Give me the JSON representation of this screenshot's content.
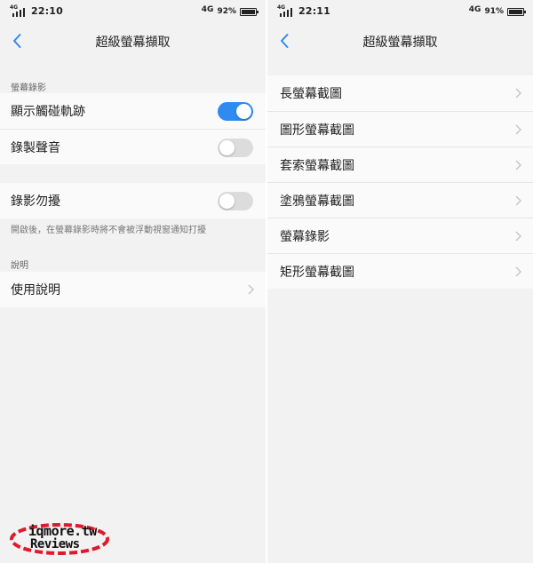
{
  "colors": {
    "accent": "#2f8bf0",
    "background": "#f2f2f2",
    "row_bg": "#fafafa",
    "watermark_ring": "#e0192b"
  },
  "left": {
    "status": {
      "network_tag": "4G",
      "time": "22:10",
      "network": "4G",
      "battery": "92%",
      "battery_level": 0.92
    },
    "title": "超級螢幕擷取",
    "section1_label": "螢幕錄影",
    "row_show_touch": {
      "label": "顯示觸碰軌跡",
      "toggle": "on"
    },
    "row_record_sound": {
      "label": "錄製聲音",
      "toggle": "off"
    },
    "row_dnd": {
      "label": "錄影勿擾",
      "toggle": "off"
    },
    "dnd_hint": "開啟後，在螢幕錄影時將不會被浮動視窗通知打擾",
    "section2_label": "說明",
    "row_instructions": {
      "label": "使用說明"
    }
  },
  "right": {
    "status": {
      "network_tag": "4G",
      "time": "22:11",
      "network": "4G",
      "battery": "91%",
      "battery_level": 0.91
    },
    "title": "超級螢幕擷取",
    "items": [
      {
        "label": "長螢幕截圖"
      },
      {
        "label": "圖形螢幕截圖"
      },
      {
        "label": "套索螢幕截圖"
      },
      {
        "label": "塗鴉螢幕截圖"
      },
      {
        "label": "螢幕錄影"
      },
      {
        "label": "矩形螢幕截圖"
      }
    ]
  },
  "watermark": {
    "line1": "iqmore.tw",
    "line2": "Reviews"
  }
}
